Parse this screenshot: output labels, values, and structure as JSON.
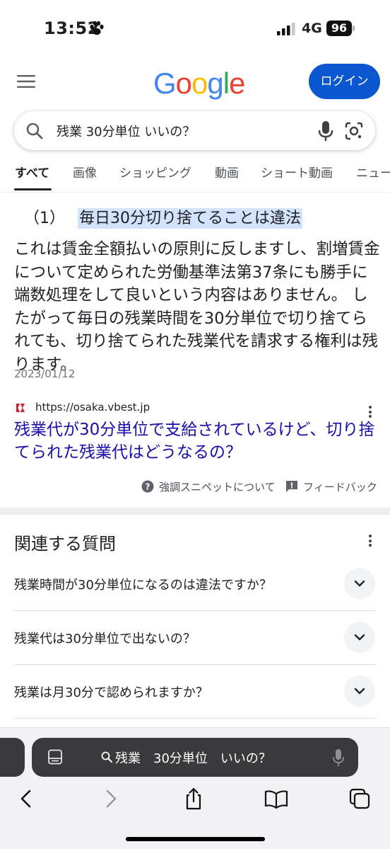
{
  "status_bar": {
    "time": "13:52",
    "network": "4G",
    "battery": "96"
  },
  "header": {
    "logo": [
      "G",
      "o",
      "o",
      "g",
      "l",
      "e"
    ],
    "logo_colors": [
      "#4285F4",
      "#EA4335",
      "#FBBC05",
      "#4285F4",
      "#34A853",
      "#EA4335"
    ],
    "login_label": "ログイン"
  },
  "search": {
    "query": "残業 30分単位 いいの？"
  },
  "tabs": [
    "すべて",
    "画像",
    "ショッピング",
    "動画",
    "ショート動画",
    "ニュー"
  ],
  "snippet": {
    "heading_number": "（1）",
    "heading_text": "毎日30分切り捨てることは違法",
    "body": "これは賃金全額払いの原則に反しますし、割増賃金について定められた労働基準法第37条にも勝手に端数処理をして良いという内容はありません。 したがって毎日の残業時間を30分単位で切り捨てられても、切り捨てられた残業代を請求する権利は残ります。",
    "date": "2023/01/12",
    "source_url": "https://osaka.vbest.jp",
    "link_title": "残業代が30分単位で支給されているけど、切り捨てられた残業代はどうなるの？",
    "about_label": "強調スニペットについて",
    "feedback_label": "フィードバック"
  },
  "related": {
    "title": "関連する質問",
    "questions": [
      "残業時間が30分単位になるのは違法ですか？",
      "残業代は30分単位で出ないの？",
      "残業は月30分で認められますか？"
    ]
  },
  "browser": {
    "address_text": "残業　30分単位　いいの？"
  },
  "colors": {
    "accent": "#0b57d0",
    "link": "#1a0dab",
    "highlight": "#d3e3fd"
  }
}
